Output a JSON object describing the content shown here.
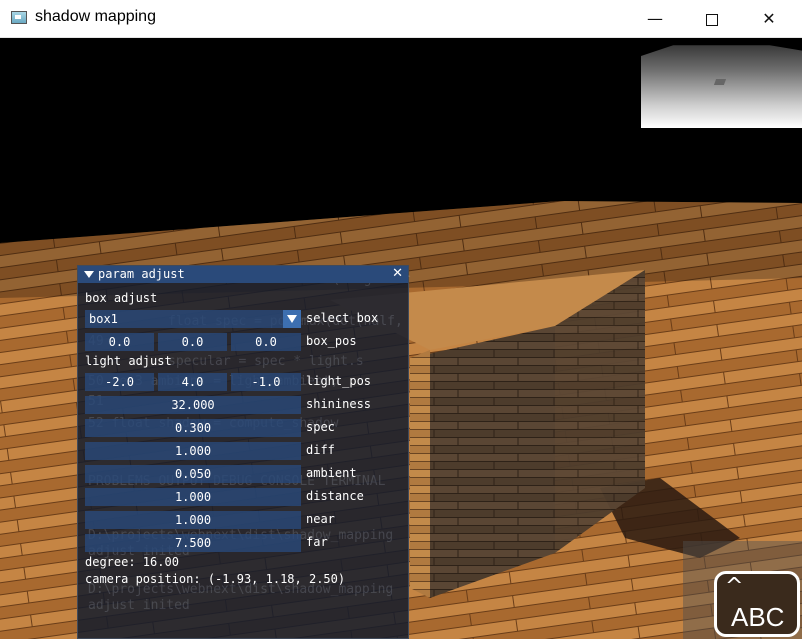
{
  "window": {
    "title": "shadow mapping",
    "minimize_glyph": "—",
    "close_glyph": "✕"
  },
  "panel": {
    "title": "param adjust",
    "close_glyph": "✕",
    "box_section": "box adjust",
    "select_box": {
      "value": "box1",
      "label": "select box"
    },
    "box_pos": {
      "values": [
        "0.0",
        "0.0",
        "0.0"
      ],
      "label": "box_pos"
    },
    "light_section": "light adjust",
    "light_pos": {
      "values": [
        "-2.0",
        "4.0",
        "-1.0"
      ],
      "label": "light_pos"
    },
    "sliders": [
      {
        "value": "32.000",
        "label": "shininess"
      },
      {
        "value": "0.300",
        "label": "spec"
      },
      {
        "value": "1.000",
        "label": "diff"
      },
      {
        "value": "0.050",
        "label": "ambient"
      },
      {
        "value": "1.000",
        "label": "distance"
      },
      {
        "value": "1.000",
        "label": "near"
      },
      {
        "value": "7.500",
        "label": "far"
      }
    ],
    "degree": "degree: 16.00",
    "camera_position": "camera position: (-1.93, 1.18, 2.50)"
  },
  "keyboard": {
    "caret": "^",
    "label": "ABC"
  },
  "colors": {
    "panel_bg": "#141c2c",
    "panel_header": "#2a4a7a",
    "field_bg": "#294a7a"
  }
}
